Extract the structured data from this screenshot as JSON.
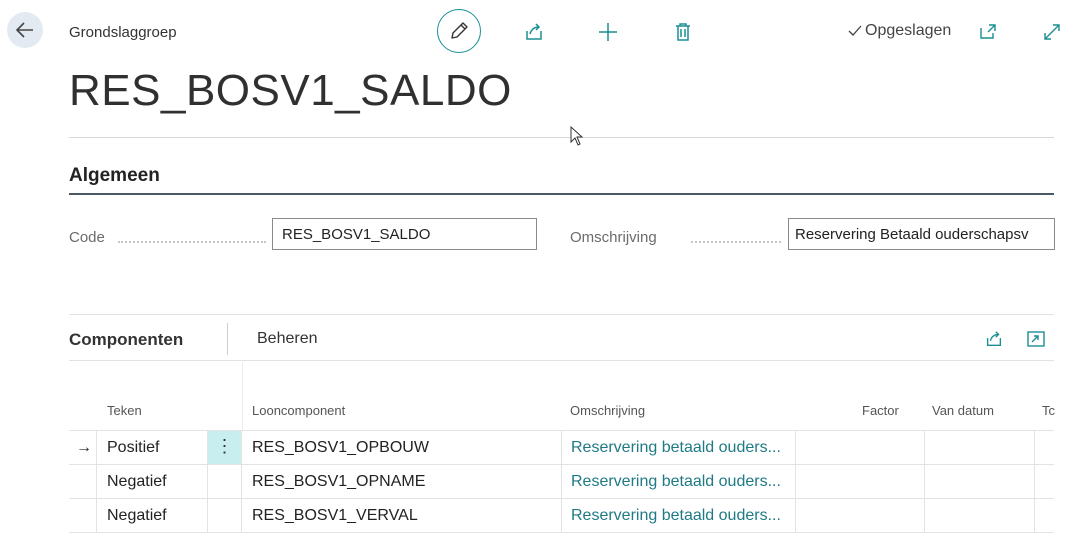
{
  "header": {
    "caption": "Grondslaggroep",
    "title": "RES_BOSV1_SALDO",
    "status": "Opgeslagen"
  },
  "general": {
    "section_title": "Algemeen",
    "code_label": "Code",
    "code_value": "RES_BOSV1_SALDO",
    "description_label": "Omschrijving",
    "description_value": "Reservering Betaald ouderschapsv"
  },
  "components": {
    "title": "Componenten",
    "action": "Beheren",
    "columns": [
      "Teken",
      "Looncomponent",
      "Omschrijving",
      "Factor",
      "Van datum",
      "Tc"
    ],
    "rows": [
      {
        "sign": "Positief",
        "component": "RES_BOSV1_OPBOUW",
        "description": "Reservering betaald ouders...",
        "selected": true
      },
      {
        "sign": "Negatief",
        "component": "RES_BOSV1_OPNAME",
        "description": "Reservering betaald ouders...",
        "selected": false
      },
      {
        "sign": "Negatief",
        "component": "RES_BOSV1_VERVAL",
        "description": "Reservering betaald ouders...",
        "selected": false
      }
    ],
    "row_marker": "→",
    "row_menu": "⋮"
  },
  "icons": {
    "back": "back-arrow-icon",
    "edit": "pencil-icon",
    "share": "share-icon",
    "new": "plus-icon",
    "delete": "trash-icon",
    "saved": "checkmark-icon",
    "open_new_window": "open-new-window-icon",
    "expand": "expand-icon",
    "focus": "focus-mode-icon"
  },
  "colors": {
    "accent": "#1a8f94",
    "link": "#1f7a85",
    "selected_cell": "#c9eef0",
    "section_rule": "#4b5964"
  }
}
